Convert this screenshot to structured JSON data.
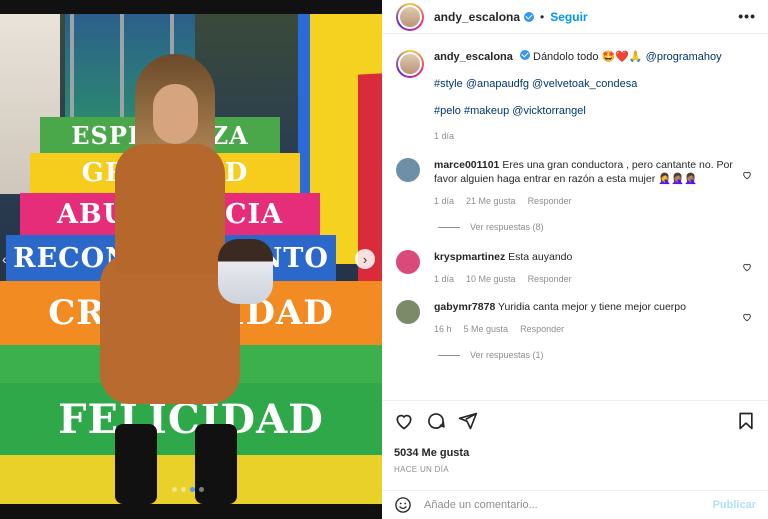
{
  "post": {
    "image": {
      "steps": [
        "ESPERANZA",
        "GRATITUD",
        "ABUNDANCIA",
        "RECONOCIMIENTO",
        "CREATIVIDAD",
        "",
        "FELICIDAD",
        ""
      ],
      "carousel_total": 4,
      "carousel_active": 2
    },
    "header": {
      "username": "andy_escalona",
      "separator": "•",
      "follow_label": "Seguir",
      "more_label": "•••"
    },
    "caption": {
      "username": "andy_escalona",
      "text": "Dándolo todo 🤩❤️🙏",
      "mention": "@programahoy",
      "line2_tags": "#style",
      "line2_mentions": "@anapaudfg @velvetoak_condesa",
      "line3_tags": "#pelo #makeup",
      "line3_mention": "@vicktorrangel",
      "time": "1 día"
    },
    "comments": [
      {
        "username": "marce001101",
        "text": "Eres una gran conductora , pero cantante no. Por favor alguien haga entrar en razón a esta mujer 🤦‍♀️🤦🏽‍♀️🤦🏽‍♀️",
        "time": "1 día",
        "likes": "21 Me gusta",
        "reply": "Responder",
        "view_replies": "Ver respuestas (8)",
        "avatar_color": "#6e8fa6"
      },
      {
        "username": "kryspmartinez",
        "text": "Esta auyando",
        "time": "1 día",
        "likes": "10 Me gusta",
        "reply": "Responder",
        "view_replies": "",
        "avatar_color": "#d94a7a"
      },
      {
        "username": "gabymr7878",
        "text": "Yuridia canta mejor y tiene mejor cuerpo",
        "time": "16 h",
        "likes": "5 Me gusta",
        "reply": "Responder",
        "view_replies": "Ver respuestas (1)",
        "avatar_color": "#7d8a6a"
      }
    ],
    "likes": "5034 Me gusta",
    "posted": "HACE UN DÍA",
    "add_comment_placeholder": "Añade un comentario...",
    "publish_label": "Publicar",
    "colors": {
      "link": "#00376b",
      "follow": "#0095f6",
      "muted": "#8e8e8e",
      "publish_disabled": "#b2dffc"
    }
  }
}
